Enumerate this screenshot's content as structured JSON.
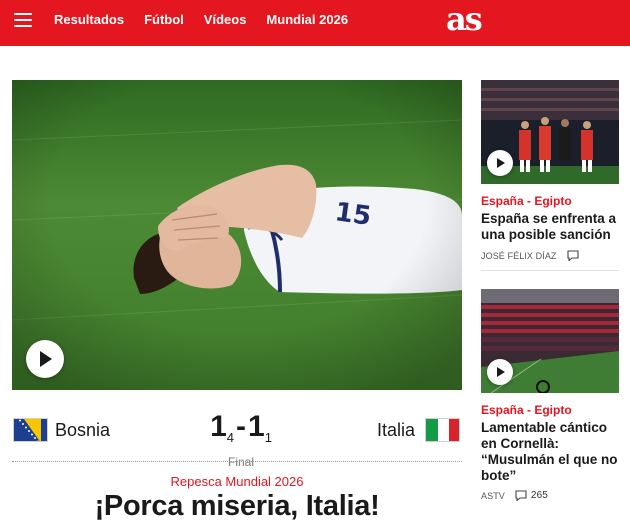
{
  "header": {
    "logo_text": "as",
    "nav": [
      {
        "label": "Resultados"
      },
      {
        "label": "Fútbol"
      },
      {
        "label": "Vídeos"
      },
      {
        "label": "Mundial 2026"
      }
    ],
    "brand_color": "#e4161f"
  },
  "main": {
    "has_video": true,
    "match": {
      "home_team": "Bosnia",
      "home_goals": "1",
      "home_penalties": "4",
      "separator": "-",
      "away_goals": "1",
      "away_penalties": "1",
      "away_team": "Italia",
      "status": "Final"
    },
    "kicker": "Repesca Mundial 2026",
    "headline": "¡Porca miseria, Italia!"
  },
  "side": [
    {
      "kicker": "España - Egipto",
      "title": "España se enfrenta a una posible sanción",
      "author": "JOSÉ FÉLIX DÍAZ",
      "comments": "",
      "has_video": true
    },
    {
      "kicker": "España - Egipto",
      "title": "Lamentable cántico en Cornellà: “Musulmán el que no bote”",
      "author": "ASTV",
      "comments": "265",
      "has_video": true
    }
  ]
}
